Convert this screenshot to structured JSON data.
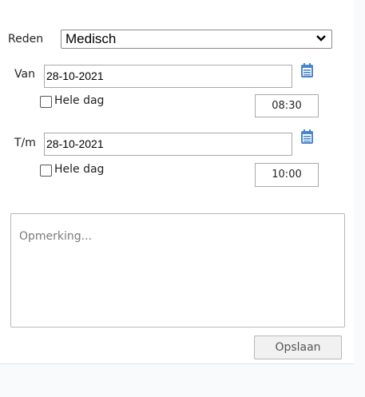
{
  "form": {
    "reason_label": "Reden",
    "reason_value": "Medisch",
    "from_label": "Van",
    "from_date": "28-10-2021",
    "from_allday_label": "Hele dag",
    "from_allday_checked": false,
    "from_time": "08:30",
    "to_label": "T/m",
    "to_date": "28-10-2021",
    "to_allday_label": "Hele dag",
    "to_allday_checked": false,
    "to_time": "10:00",
    "remark_placeholder": "Opmerking...",
    "save_label": "Opslaan"
  },
  "icons": {
    "calendar": "calendar-icon",
    "dropdown": "chevron-down-icon"
  },
  "colors": {
    "calendar_icon": "#4a86c8",
    "panel_bg": "#ffffff",
    "page_bg": "#f8fafc"
  }
}
